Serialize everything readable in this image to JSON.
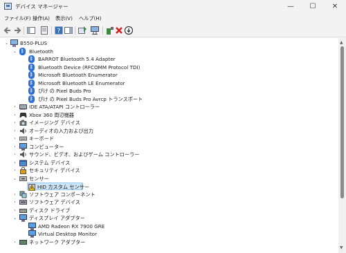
{
  "window": {
    "title": "デバイス マネージャー",
    "controls": {
      "minimize": "—",
      "maximize": "☐",
      "close": "✕"
    }
  },
  "menu": {
    "file": "ファイル(F)",
    "action": "操作(A)",
    "view": "表示(V)",
    "help": "ヘルプ(H)"
  },
  "toolbar": {
    "icons": [
      "back-arrow-icon",
      "forward-arrow-icon",
      "show-hide-console-tree-icon",
      "properties-icon",
      "help-icon",
      "action-pane-icon",
      "update-driver-icon",
      "scan-hardware-icon",
      "add-driver-icon",
      "uninstall-device-icon",
      "disable-device-icon"
    ]
  },
  "tree": {
    "root": "B550-PLUS",
    "bluetooth": {
      "label": "Bluetooth",
      "children": [
        "BARROT Bluetooth 5.4 Adapter",
        "Bluetooth Device (RFCOMM Protocol TDI)",
        "Microsoft Bluetooth Enumerator",
        "Microsoft Bluetooth LE Enumerator",
        "ぴけ の Pixel Buds Pro",
        "ぴけ の Pixel Buds Pro Avrcp トランスポート"
      ]
    },
    "categories": [
      "IDE ATA/ATAPI コントローラー",
      "Xbox 360 周辺機器",
      "イメージング デバイス",
      "オーディオの入力および出力",
      "キーボード",
      "コンピューター",
      "サウンド、ビデオ、およびゲーム コントローラー",
      "システム デバイス",
      "セキュリティ デバイス"
    ],
    "sensor": {
      "label": "センサー",
      "child": "HID カスタム センサー"
    },
    "categories2": [
      "ソフトウェア コンポーネント",
      "ソフトウェア デバイス",
      "ディスク ドライブ"
    ],
    "display": {
      "label": "ディスプレイ アダプター",
      "children": [
        "AMD Radeon RX 7900 GRE",
        "Virtual Desktop Monitor"
      ]
    },
    "partial": "ネットワーク アダプター"
  },
  "colors": {
    "selection": "#cce4f7",
    "bluetooth": "#2b6fd6",
    "delete": "#d42020"
  }
}
